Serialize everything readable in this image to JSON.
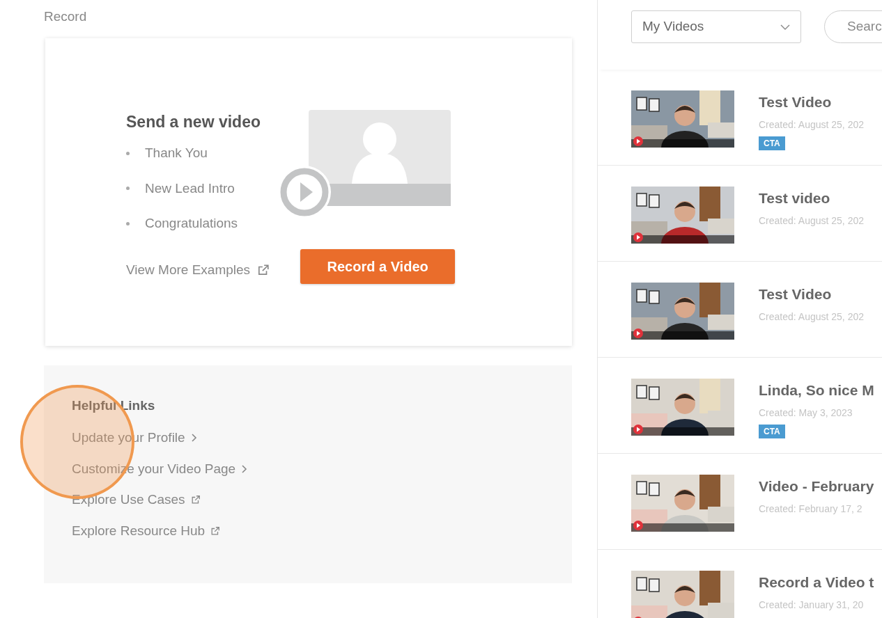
{
  "section_label": "Record",
  "card": {
    "title": "Send a new video",
    "items": [
      "Thank You",
      "New Lead Intro",
      "Congratulations"
    ],
    "link": "View More Examples",
    "button": "Record a Video"
  },
  "helpful_links": {
    "title": "Helpful Links",
    "links": [
      {
        "label": "Update your Profile",
        "kind": "arrow"
      },
      {
        "label": "Customize your Video Page",
        "kind": "arrow"
      },
      {
        "label": "Explore Use Cases",
        "kind": "external"
      },
      {
        "label": "Explore Resource Hub",
        "kind": "external"
      }
    ]
  },
  "video_panel": {
    "filter": {
      "value": "My Videos"
    },
    "search": {
      "label": "Searc"
    },
    "videos": [
      {
        "title": "Test Video",
        "created": "Created: August 25, 202",
        "badge": "CTA"
      },
      {
        "title": "Test video",
        "created": "Created: August 25, 202"
      },
      {
        "title": "Test Video",
        "created": "Created: August 25, 202"
      },
      {
        "title": "Linda, So nice M",
        "created": "Created: May 3, 2023",
        "badge": "CTA"
      },
      {
        "title": "Video - February",
        "created": "Created: February 17, 2"
      },
      {
        "title": "Record a Video t",
        "created": "Created: January 31, 20"
      }
    ]
  }
}
